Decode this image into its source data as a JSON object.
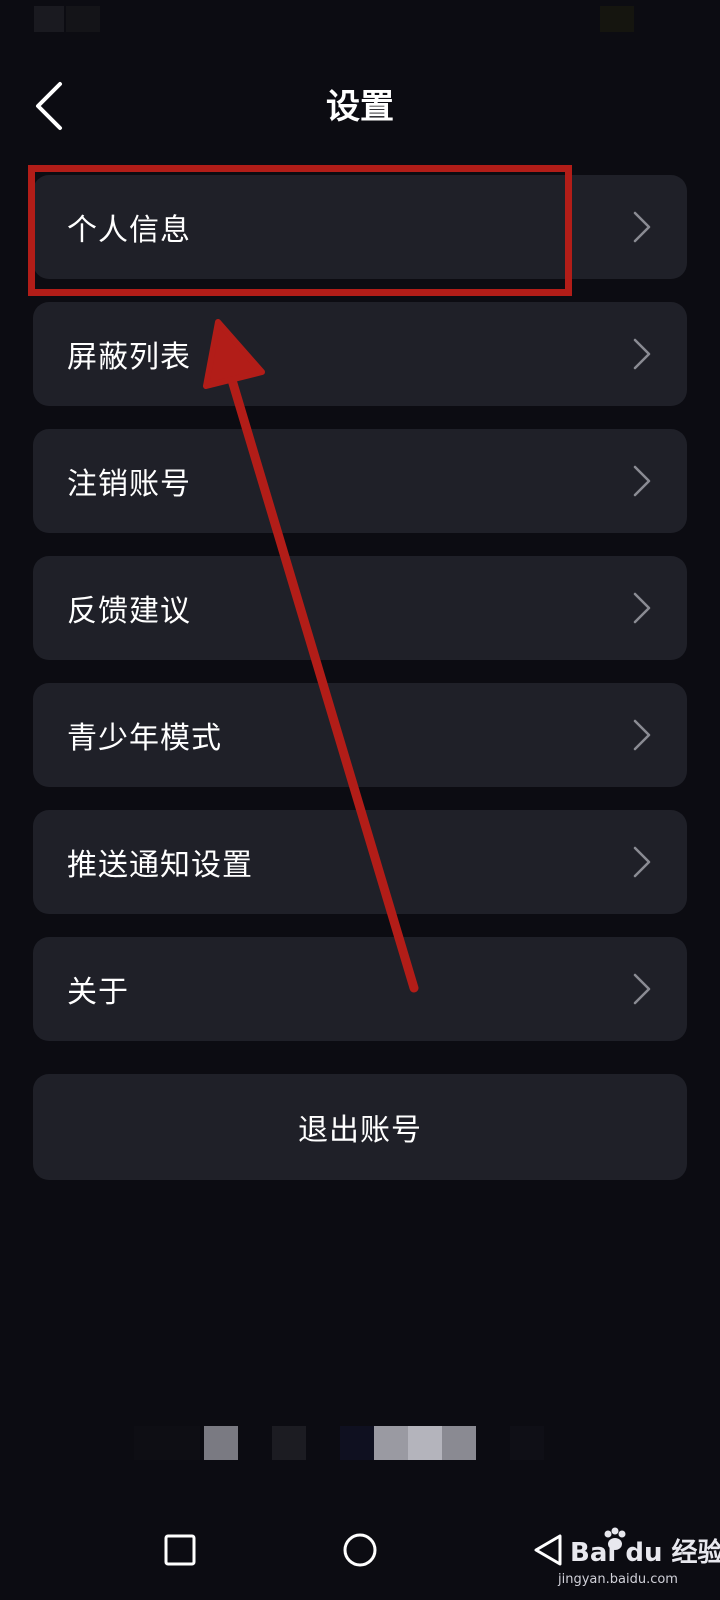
{
  "header": {
    "title": "设置",
    "back_icon": "chevron-left-icon"
  },
  "menu": {
    "items": [
      {
        "label": "个人信息",
        "icon": "chevron-right-icon"
      },
      {
        "label": "屏蔽列表",
        "icon": "chevron-right-icon"
      },
      {
        "label": "注销账号",
        "icon": "chevron-right-icon"
      },
      {
        "label": "反馈建议",
        "icon": "chevron-right-icon"
      },
      {
        "label": "青少年模式",
        "icon": "chevron-right-icon"
      },
      {
        "label": "推送通知设置",
        "icon": "chevron-right-icon"
      },
      {
        "label": "关于",
        "icon": "chevron-right-icon"
      }
    ]
  },
  "logout": {
    "label": "退出账号"
  },
  "annotation": {
    "highlight_color": "#b21d18"
  },
  "nav_bar": {
    "recent_icon": "square-icon",
    "home_icon": "circle-icon",
    "back_icon": "triangle-back-icon"
  },
  "watermark": {
    "brand": "Bai du 经验",
    "url": "jingyan.baidu.com"
  },
  "colors": {
    "background": "#0c0c12",
    "card": "#1f2028",
    "text": "#ffffff",
    "chevron": "#8a8b93"
  }
}
